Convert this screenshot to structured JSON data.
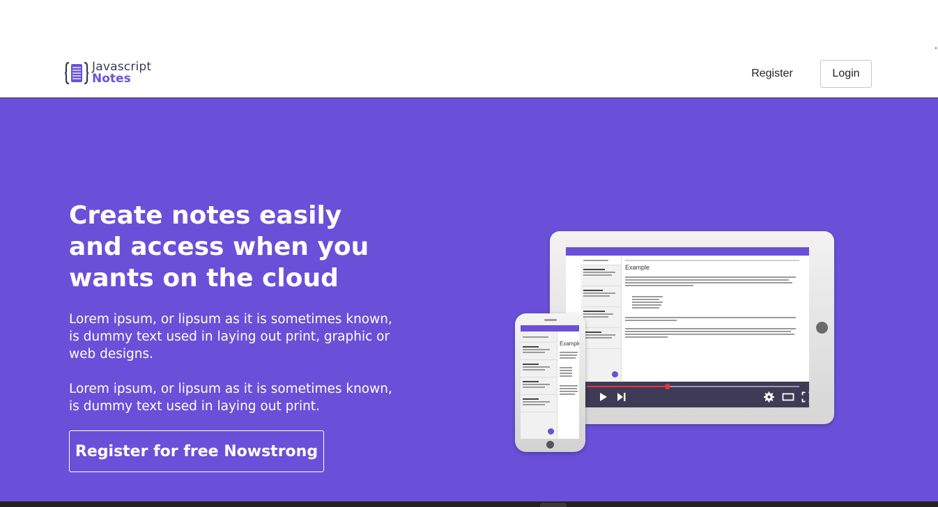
{
  "brand": {
    "line1": "Javascript",
    "line2": "Notes",
    "icon": "notebook-braces-icon"
  },
  "nav": {
    "register_label": "Register",
    "login_label": "Login"
  },
  "hero": {
    "title": "Create notes easily and access when you wants on the cloud",
    "paragraph1": "Lorem ipsum, or lipsum as it is sometimes known, is dummy text used in laying out print, graphic or web designs.",
    "paragraph2": "Lorem ipsum, or lipsum as it is sometimes known, is dummy text used in laying out print.",
    "cta_label": "Register for free Nowstrong",
    "background_color": "#6a50d8"
  },
  "illustration": {
    "tablet_note_title": "Example",
    "phone_note_title": "Example",
    "video_progress": 0.38,
    "icons": [
      "play-icon",
      "skip-next-icon",
      "settings-gear-icon",
      "theater-mode-icon",
      "fullscreen-icon"
    ]
  }
}
